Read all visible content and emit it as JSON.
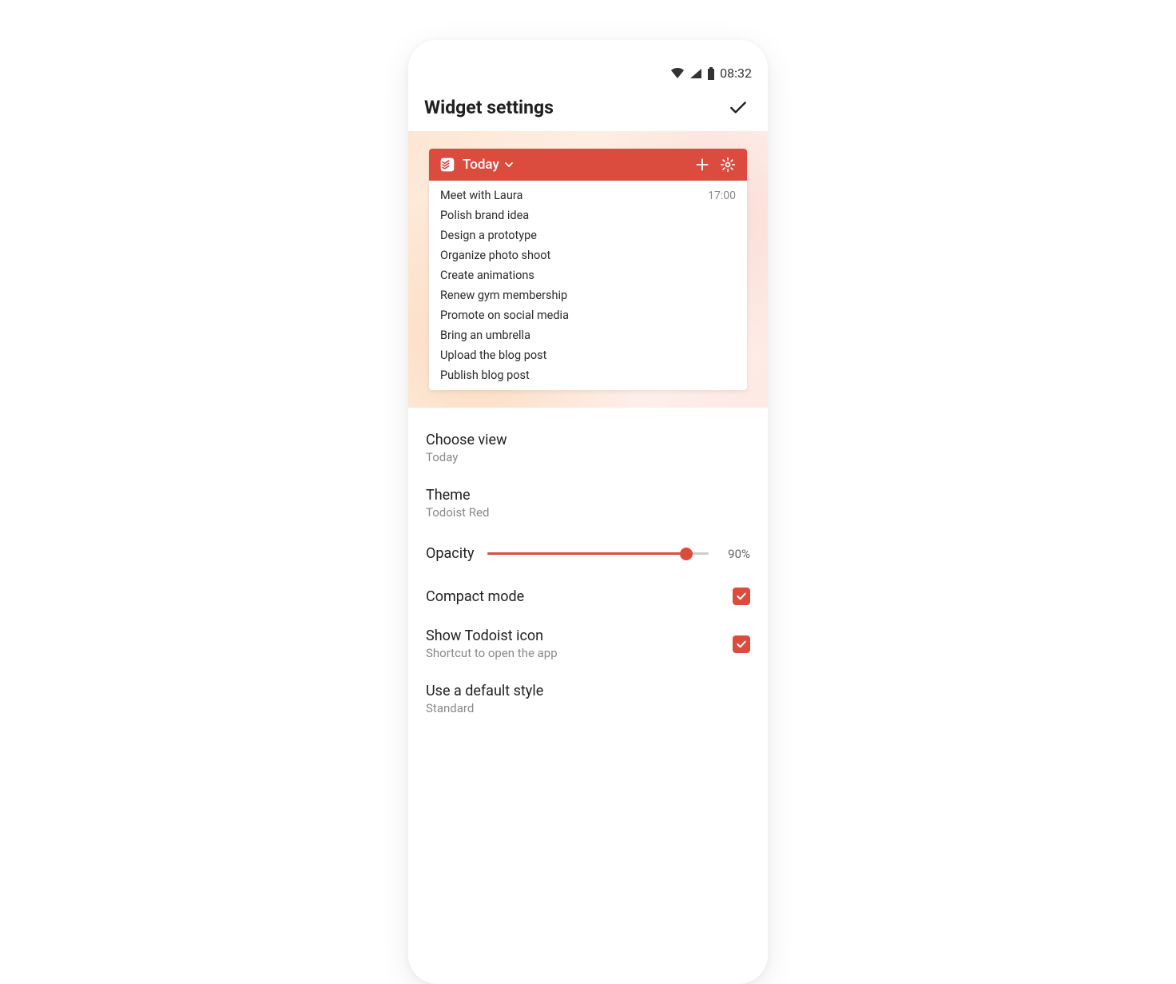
{
  "status_bar": {
    "time": "08:32"
  },
  "header": {
    "title": "Widget settings"
  },
  "widget": {
    "filter_label": "Today",
    "tasks": [
      {
        "title": "Meet with Laura",
        "time": "17:00"
      },
      {
        "title": "Polish brand idea",
        "time": ""
      },
      {
        "title": "Design a prototype",
        "time": ""
      },
      {
        "title": "Organize photo shoot",
        "time": ""
      },
      {
        "title": "Create animations",
        "time": ""
      },
      {
        "title": "Renew gym membership",
        "time": ""
      },
      {
        "title": "Promote on social media",
        "time": ""
      },
      {
        "title": "Bring an umbrella",
        "time": ""
      },
      {
        "title": "Upload the blog post",
        "time": ""
      },
      {
        "title": "Publish blog post",
        "time": ""
      }
    ]
  },
  "settings": {
    "choose_view": {
      "label": "Choose view",
      "value": "Today"
    },
    "theme": {
      "label": "Theme",
      "value": "Todoist Red"
    },
    "opacity": {
      "label": "Opacity",
      "value_pct": "90%",
      "fill_pct": "90%"
    },
    "compact_mode": {
      "label": "Compact mode",
      "checked": true
    },
    "show_icon": {
      "label": "Show Todoist icon",
      "subtitle": "Shortcut to open the app",
      "checked": true
    },
    "default_style": {
      "label": "Use a default style",
      "value": "Standard"
    }
  },
  "colors": {
    "accent": "#db4c3f"
  }
}
